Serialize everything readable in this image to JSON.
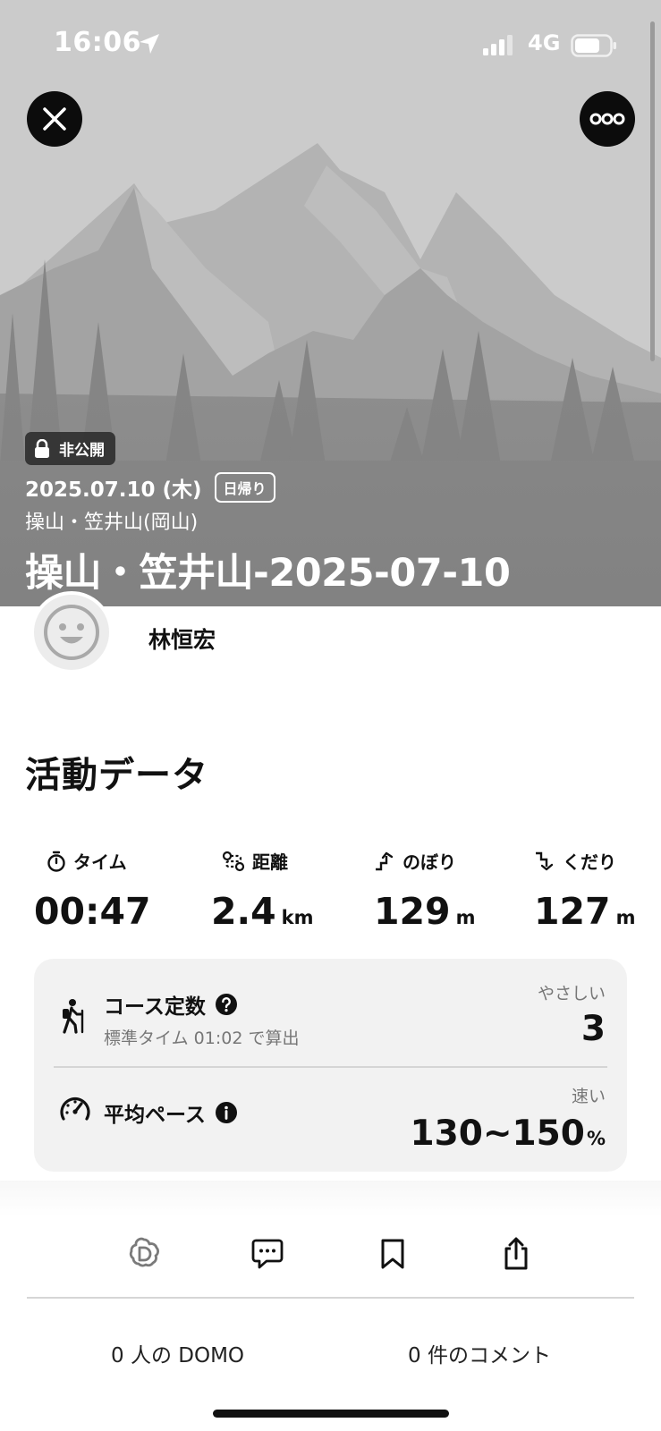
{
  "status_bar": {
    "time": "16:06",
    "network": "4G"
  },
  "hero": {
    "visibility_badge": "非公開",
    "date": "2025.07.10 (木)",
    "trip_type": "日帰り",
    "area": "操山・笠井山(岡山)",
    "title": "操山・笠井山-2025-07-10"
  },
  "user": {
    "name": "林恒宏"
  },
  "activity": {
    "section_title": "活動データ",
    "stats": [
      {
        "label": "タイム",
        "value": "00:47",
        "unit": "",
        "icon": "stopwatch-icon"
      },
      {
        "label": "距離",
        "value": "2.4",
        "unit": "km",
        "icon": "route-icon"
      },
      {
        "label": "のぼり",
        "value": "129",
        "unit": "m",
        "icon": "ascent-icon"
      },
      {
        "label": "くだり",
        "value": "127",
        "unit": "m",
        "icon": "descent-icon"
      }
    ],
    "course_constant": {
      "label": "コース定数",
      "sub": "標準タイム 01:02 で算出",
      "right_label": "やさしい",
      "value": "3",
      "icon": "hiker-icon"
    },
    "avg_pace": {
      "label": "平均ペース",
      "right_label": "速い",
      "value": "130~150",
      "unit": "%",
      "icon": "speedometer-icon"
    }
  },
  "bottom": {
    "domo_count": "0 人の DOMO",
    "comment_count": "0 件のコメント"
  },
  "colors": {
    "hero_bg": "#cbcbcb",
    "card_bg": "#f2f2f2",
    "dark": "#0c0c0c"
  }
}
